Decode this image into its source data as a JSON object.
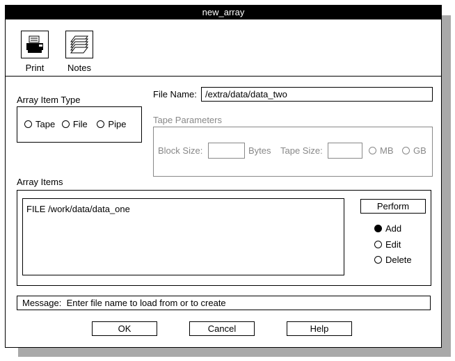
{
  "window": {
    "title": "new_array"
  },
  "toolbar": {
    "print_label": "Print",
    "notes_label": "Notes"
  },
  "item_type": {
    "label": "Array Item Type",
    "options": [
      "Tape",
      "File",
      "Pipe"
    ]
  },
  "file_name": {
    "label": "File Name:",
    "value": "/extra/data/data_two"
  },
  "tape": {
    "label": "Tape Parameters",
    "block_size_label": "Block Size:",
    "block_size_value": "",
    "bytes_label": "Bytes",
    "tape_size_label": "Tape Size:",
    "tape_size_value": "",
    "mb_label": "MB",
    "gb_label": "GB"
  },
  "array_items": {
    "label": "Array Items",
    "items": [
      "FILE /work/data/data_one"
    ],
    "perform_label": "Perform",
    "actions": {
      "add": "Add",
      "edit": "Edit",
      "delete": "Delete",
      "selected": "Add"
    }
  },
  "message": {
    "label": "Message:",
    "text": "Enter file name to load from or to create"
  },
  "buttons": {
    "ok": "OK",
    "cancel": "Cancel",
    "help": "Help"
  }
}
